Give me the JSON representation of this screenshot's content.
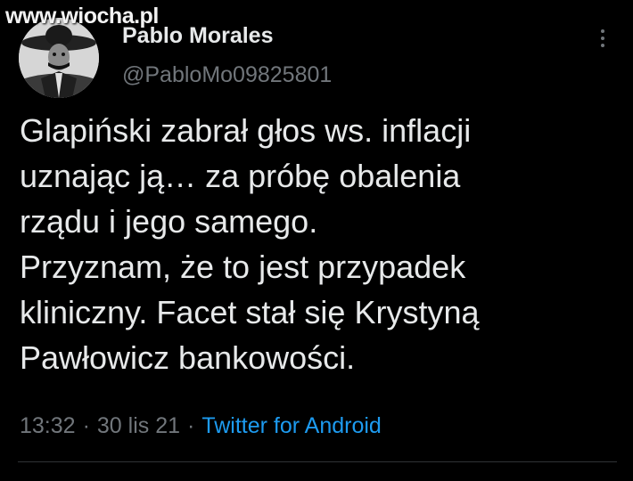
{
  "watermark": "www.wiocha.pl",
  "author": {
    "display_name": "Pablo Morales",
    "handle": "@PabloMo09825801",
    "avatar_icon": "avatar-photo"
  },
  "menu": {
    "icon": "more-vertical-icon"
  },
  "tweet": {
    "lines": [
      "Glapiński zabrał głos ws. inflacji",
      "uznając ją… za próbę obalenia",
      "rządu i jego samego.",
      "Przyznam, że to jest przypadek",
      "kliniczny. Facet stał się Krystyną",
      "Pawłowicz bankowości."
    ],
    "time": "13:32",
    "separator": "·",
    "date": "30 lis 21",
    "source": "Twitter for Android"
  },
  "colors": {
    "background": "#000000",
    "text": "#e7e9ea",
    "muted": "#71767b",
    "link": "#1d9bf0"
  }
}
